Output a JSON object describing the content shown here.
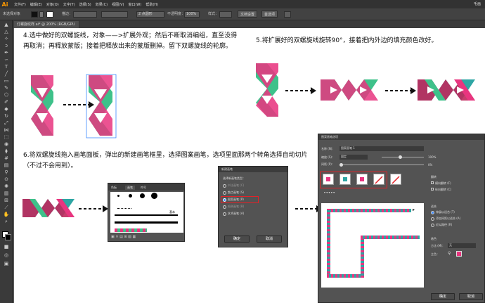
{
  "app": {
    "logo": "Ai"
  },
  "menu": [
    "文件(F)",
    "编辑(E)",
    "对象(O)",
    "文字(T)",
    "选择(S)",
    "效果(C)",
    "视图(V)",
    "窗口(W)",
    "帮助(H)"
  ],
  "menu_right": "毛画",
  "control_bar": {
    "selection_label": "未选择对象",
    "stroke_label": "描边：",
    "stroke_value": "",
    "brush_value": "2 点圆形",
    "opacity_label": "不透明度：",
    "opacity_value": "100%",
    "style_label": "样式：",
    "doc_setup_button": "文档设置",
    "prefs_button": "首选项"
  },
  "doc_tab": "灯螺旋纹样.ai* @ 200% (RGB/GPU 预览)",
  "tools": [
    "selection-tool",
    "direct-selection-tool",
    "magic-wand-tool",
    "lasso-tool",
    "pen-tool",
    "curvature-tool",
    "type-tool",
    "line-tool",
    "rectangle-tool",
    "paintbrush-tool",
    "shaper-tool",
    "pencil-tool",
    "eraser-tool",
    "rotate-tool",
    "scale-tool",
    "width-tool",
    "free-transform-tool",
    "shape-builder-tool",
    "perspective-tool",
    "mesh-tool",
    "gradient-tool",
    "eyedropper-tool",
    "blend-tool",
    "symbol-sprayer-tool",
    "graph-tool",
    "artboard-tool",
    "slice-tool",
    "hand-tool",
    "zoom-tool"
  ],
  "steps": {
    "s4": "4.选中做好的双螺旋线，对象——>扩展外观；然后不断取消编组，直至没得再取消；再释放蒙版；接着把释放出来的蒙版删掉。留下双螺旋线的轮廓。",
    "s5": "5.将扩展好的双螺旋线旋转90°，接着把内外边的填充颜色改好。",
    "s6": "6.将双螺旋线拖入画笔面板，弹出的新建画笔框里，选择图案画笔，选项里面那两个转角选择自动切片（不过不会用到）。"
  },
  "brush_panel": {
    "tabs": [
      "色板",
      "画笔",
      "符号"
    ],
    "basic_label": "基本"
  },
  "new_brush_dialog": {
    "title": "新建画笔",
    "prompt": "选择新画笔类型：",
    "options": [
      "书法画笔 (C)",
      "散点画笔 (S)",
      "图案画笔 (P)",
      "毛刷画笔 (B)",
      "艺术画笔 (A)"
    ],
    "ok": "确定",
    "cancel": "取消"
  },
  "pattern_dialog": {
    "title": "图案画笔选项",
    "name_label": "名称 (N)：",
    "name_value": "图案画笔 1",
    "scale_label": "缩放 (S)：",
    "scale_mode": "固定",
    "scale_value": "100%",
    "spacing_label": "间距 (P)：",
    "spacing_value": "0%",
    "flip_label": "翻转",
    "flip_along": "横向翻转 (F)",
    "flip_across": "纵向翻转 (C)",
    "fit_label": "适合",
    "fit_options": [
      "伸展以适合 (T)",
      "添加间距以适合 (A)",
      "近似路径 (R)"
    ],
    "colorize_label": "着色",
    "method_label": "方法 (M)：",
    "method_value": "无",
    "key_color_label": "主色：",
    "ok": "确定",
    "cancel": "取消"
  },
  "colors": {
    "pink": "#e8357f",
    "green": "#3ec18a",
    "teal": "#2ea6a4",
    "crimson": "#c0285c",
    "accent_red": "#e32228"
  }
}
